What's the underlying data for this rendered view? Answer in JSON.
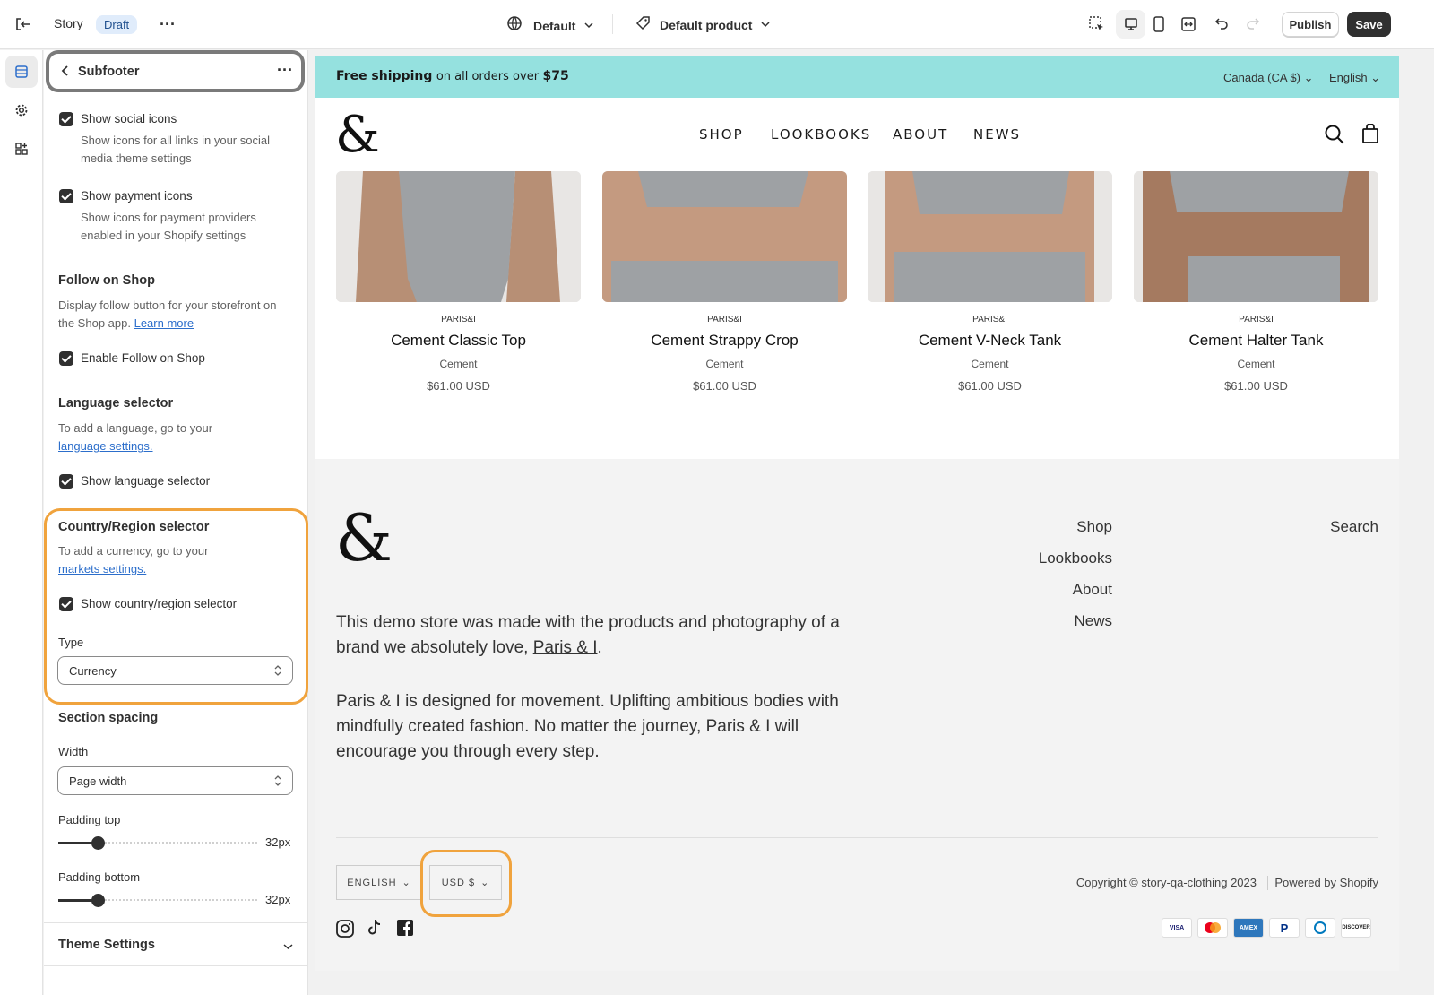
{
  "topbar": {
    "story": "Story",
    "draft_badge": "Draft",
    "theme_select": "Default",
    "product_select": "Default product",
    "publish_label": "Publish",
    "save_label": "Save"
  },
  "panel": {
    "title": "Subfooter",
    "social": {
      "label": "Show social icons",
      "help": "Show icons for all links in your social media theme settings"
    },
    "payment": {
      "label": "Show payment icons",
      "help": "Show icons for payment providers enabled in your Shopify settings"
    },
    "follow": {
      "heading": "Follow on Shop",
      "help": "Display follow button for your storefront on the Shop app.",
      "link": "Learn more",
      "checkbox": "Enable Follow on Shop"
    },
    "language": {
      "heading": "Language selector",
      "help": "To add a language, go to your",
      "link": "language settings.",
      "checkbox": "Show language selector"
    },
    "country": {
      "heading": "Country/Region selector",
      "help": "To add a currency, go to your",
      "link": "markets settings.",
      "checkbox": "Show country/region selector",
      "type_label": "Type",
      "type_value": "Currency"
    },
    "spacing": {
      "heading": "Section spacing",
      "width_label": "Width",
      "width_value": "Page width",
      "padding_top_label": "Padding top",
      "padding_top_value": "32px",
      "padding_bottom_label": "Padding bottom",
      "padding_bottom_value": "32px"
    },
    "theme_settings": "Theme Settings"
  },
  "store": {
    "banner": {
      "bold": "Free shipping",
      "middle": "on all orders over",
      "amount": "$75",
      "country": "Canada (CA $)",
      "language": "English"
    },
    "nav": [
      "SHOP",
      "LOOKBOOKS",
      "ABOUT",
      "NEWS"
    ],
    "products": [
      {
        "vendor": "PARIS&I",
        "name": "Cement Classic Top",
        "color": "Cement",
        "price": "$61.00 USD"
      },
      {
        "vendor": "PARIS&I",
        "name": "Cement Strappy Crop",
        "color": "Cement",
        "price": "$61.00 USD"
      },
      {
        "vendor": "PARIS&I",
        "name": "Cement V-Neck Tank",
        "color": "Cement",
        "price": "$61.00 USD"
      },
      {
        "vendor": "PARIS&I",
        "name": "Cement Halter Tank",
        "color": "Cement",
        "price": "$61.00 USD"
      }
    ],
    "footer": {
      "para1_a": "This demo store was made with the products and photography of a brand we absolutely love,",
      "para1_link": "Paris & I",
      "para1_end": ".",
      "para2": "Paris & I is designed for movement. Uplifting ambitious bodies with mindfully created fashion. No matter the journey, Paris & I will encourage you through every step.",
      "links": [
        "Shop",
        "Lookbooks",
        "About",
        "News"
      ],
      "search": "Search",
      "language_button": "ENGLISH",
      "currency_button": "USD $",
      "copyright": "Copyright © story-qa-clothing 2023",
      "powered": "Powered by Shopify",
      "payments": [
        "VISA",
        "MC",
        "AMEX",
        "PayPal",
        "Diners",
        "DISCOVER"
      ]
    }
  },
  "colors": {
    "highlight_orange": "#f0a33d",
    "banner_teal": "#95e1df",
    "link_blue": "#2c6ecb"
  }
}
